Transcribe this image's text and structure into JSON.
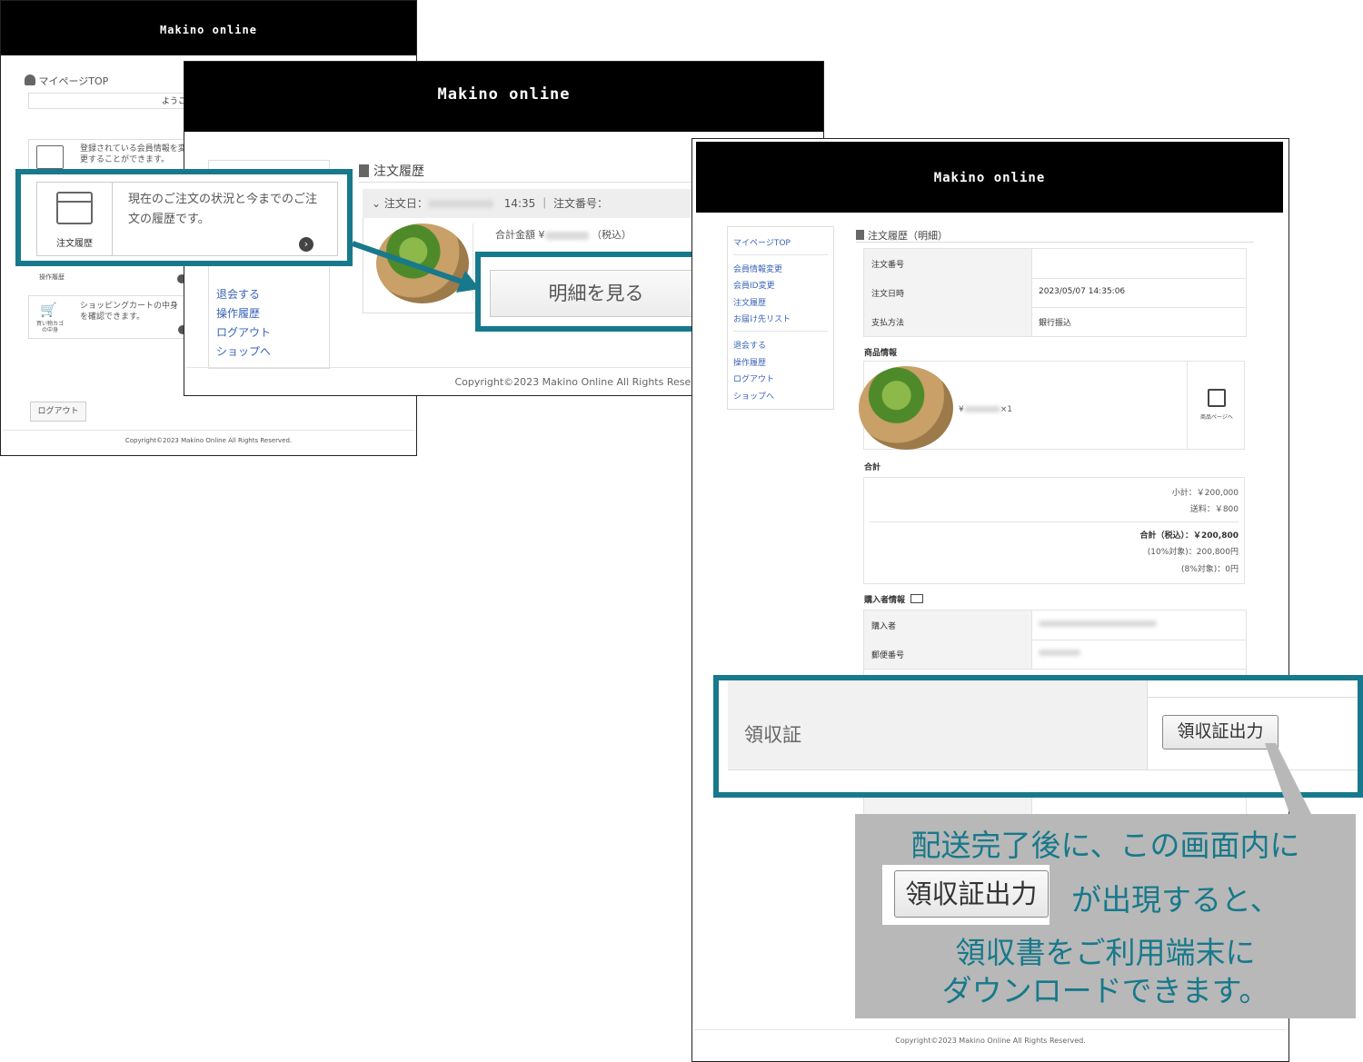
{
  "brand": "Makino online",
  "mypage": {
    "top_label": "マイページTOP",
    "welcome": "ようこそ",
    "card1_text": "登録されている会員情報を変更することができます。",
    "history_label": "注文履歴",
    "history_desc": "現在のご注文の状況と今までのご注文の履歴です。",
    "ops_label": "操作履歴",
    "cart_label": "買い物カゴの中身",
    "cart_desc": "ショッピングカートの中身を確認できます。",
    "logout_button": "ログアウト",
    "copyright": "Copyright©2023 Makino Online All Rights Reserved."
  },
  "orders": {
    "title": "注文履歴",
    "order_date_label": "注文日：",
    "order_time": "14:35",
    "order_no_label": "注文番号：",
    "total_label": "合計金額 ¥",
    "tax_note": "（税込）",
    "detail_button": "明細を見る",
    "menu": [
      "退会する",
      "操作履歴",
      "ログアウト",
      "ショップへ"
    ],
    "copyright": "Copyright©2023 Makino Online All Rights Reserved."
  },
  "detail": {
    "title": "注文履歴（明細）",
    "sidebar": [
      "マイページTOP",
      "会員情報変更",
      "会員ID変更",
      "注文履歴",
      "お届け先リスト",
      "退会する",
      "操作履歴",
      "ログアウト",
      "ショップへ"
    ],
    "rows": [
      {
        "label": "注文番号",
        "value": ""
      },
      {
        "label": "注文日時",
        "value": "2023/05/07  14:35:06"
      },
      {
        "label": "支払方法",
        "value": "銀行振込"
      }
    ],
    "product_section": "商品情報",
    "product_qty": "×1",
    "product_page": "商品ページへ",
    "total_section": "合計",
    "subtotal": "小計：￥200,000",
    "shipping": "送料：￥800",
    "grand_total": "合計（税込）：￥200,800",
    "tax10": "(10%対象)：200,800円",
    "tax8": "(8%対象)：0円",
    "buyer_section": "購入者情報",
    "buyer_rows": [
      {
        "label": "購入者"
      },
      {
        "label": "郵便番号"
      }
    ],
    "copyright": "Copyright©2023 Makino Online All Rights Reserved."
  },
  "receipt": {
    "label": "領収証",
    "button": "領収証出力"
  },
  "note": {
    "line1": "配送完了後に、この画面内に",
    "button": "領収証出力",
    "line2_suffix": "が出現すると、",
    "line3": "領収書をご利用端末に",
    "line4": "ダウンロードできます。"
  },
  "colors": {
    "accent": "#17798b",
    "note_bg": "#b8b8b8",
    "note_text": "#17798b"
  }
}
